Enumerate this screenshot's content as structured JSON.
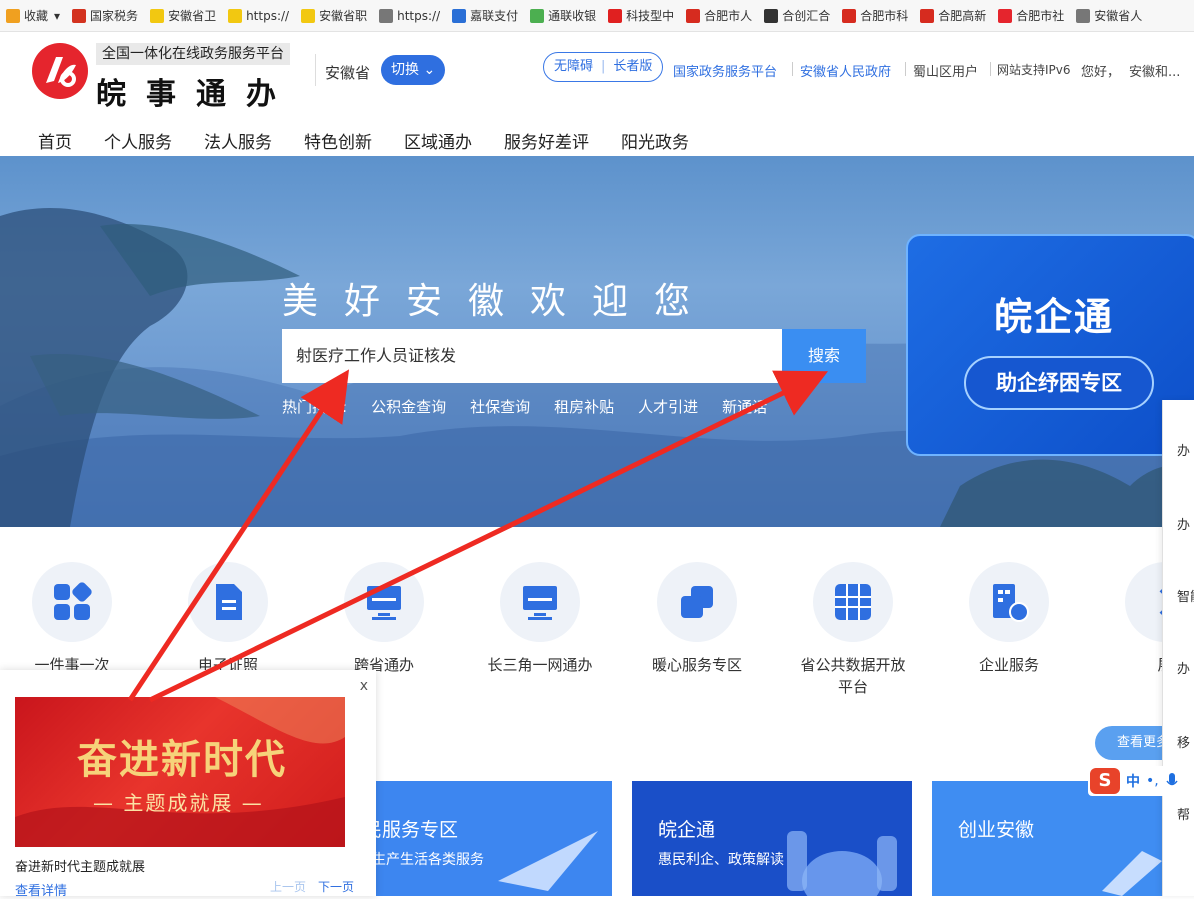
{
  "bookmarks": [
    {
      "label": "收藏",
      "icon": "star-icon",
      "color": "#f0a020"
    },
    {
      "label": "国家税务",
      "icon": "tax-icon",
      "color": "#d3321f"
    },
    {
      "label": "安徽省卫",
      "icon": "folder-icon",
      "color": "#f2c811"
    },
    {
      "label": "https://",
      "icon": "folder-icon",
      "color": "#f2c811"
    },
    {
      "label": "安徽省职",
      "icon": "folder-icon",
      "color": "#f2c811"
    },
    {
      "label": "https://",
      "icon": "globe-icon",
      "color": "#777777"
    },
    {
      "label": "嘉联支付",
      "icon": "vscode-icon",
      "color": "#2a6fd6"
    },
    {
      "label": "通联收银",
      "icon": "pinwheel-icon",
      "color": "#4caf50"
    },
    {
      "label": "科技型中",
      "icon": "flag-icon",
      "color": "#e02020"
    },
    {
      "label": "合肥市人",
      "icon": "emblem-icon",
      "color": "#d62b1f"
    },
    {
      "label": "合创汇合",
      "icon": "house-icon",
      "color": "#333333"
    },
    {
      "label": "合肥市科",
      "icon": "emblem-icon",
      "color": "#d62b1f"
    },
    {
      "label": "合肥高新",
      "icon": "emblem-icon",
      "color": "#d62b1f"
    },
    {
      "label": "合肥市社",
      "icon": "anhui-logo-icon",
      "color": "#e5252d"
    },
    {
      "label": "安徽省人",
      "icon": "globe-icon",
      "color": "#777777"
    }
  ],
  "header": {
    "logo_subtitle": "全国一体化在线政务服务平台",
    "logo_title": "皖事通办",
    "province": "安徽省",
    "switch_label": "切换",
    "accessibility": "无障碍",
    "elderly": "长者版",
    "links": {
      "national": "国家政务服务平台",
      "provincial": "安徽省人民政府",
      "user": "蜀山区用户",
      "ipv6": "网站支持IPv6",
      "greeting": "您好，",
      "user_name": "安徽和..."
    }
  },
  "nav": [
    "首页",
    "个人服务",
    "法人服务",
    "特色创新",
    "区域通办",
    "服务好差评",
    "阳光政务"
  ],
  "banner": {
    "welcome": "美好安徽欢迎您",
    "search_value": "射医疗工作人员证核发",
    "search_button": "搜索",
    "hot_label": "热门搜索:",
    "hot_items": [
      "公积金查询",
      "社保查询",
      "租房补贴",
      "人才引进",
      "新通话"
    ],
    "wanqitong_title": "皖企通",
    "wanqitong_button": "助企纾困专区"
  },
  "services": [
    {
      "label": "一件事一次",
      "icon": "apps-icon"
    },
    {
      "label": "电子证照",
      "icon": "document-icon"
    },
    {
      "label": "跨省通办",
      "icon": "monitor-icon"
    },
    {
      "label": "长三角一网通办",
      "icon": "monitor-icon"
    },
    {
      "label": "暖心服务专区",
      "icon": "squares-icon"
    },
    {
      "label": "省公共数据开放平台",
      "icon": "grid-icon"
    },
    {
      "label": "企业服务",
      "icon": "building-chat-icon"
    },
    {
      "label": "展",
      "icon": "chevron-icon"
    }
  ],
  "more_button": "查看更多",
  "cards": [
    {
      "title": "惠民服务专区",
      "subtitle": "公共生产生活各类服务",
      "color": "#3d86f0"
    },
    {
      "title": "皖企通",
      "subtitle": "惠民利企、政策解读",
      "color": "#1a4fc8"
    },
    {
      "title": "创业安徽",
      "subtitle": "",
      "color": "#3f8df2"
    }
  ],
  "popup": {
    "close": "x",
    "image_title": "奋进新时代",
    "image_subtitle": "— 主题成就展 —",
    "caption": "奋进新时代主题成就展",
    "detail": "查看详情",
    "prev": "上一页",
    "next": "下一页"
  },
  "side_panel": [
    "办",
    "办",
    "智能",
    "办",
    "移",
    "帮"
  ],
  "ime": {
    "logo": "S",
    "mode": "中",
    "punct": "•,"
  },
  "colors": {
    "brand_red": "#e5252d",
    "primary_blue": "#2f6fe0",
    "search_blue": "#3a8ef2",
    "arrow_red": "#ee2a22"
  }
}
